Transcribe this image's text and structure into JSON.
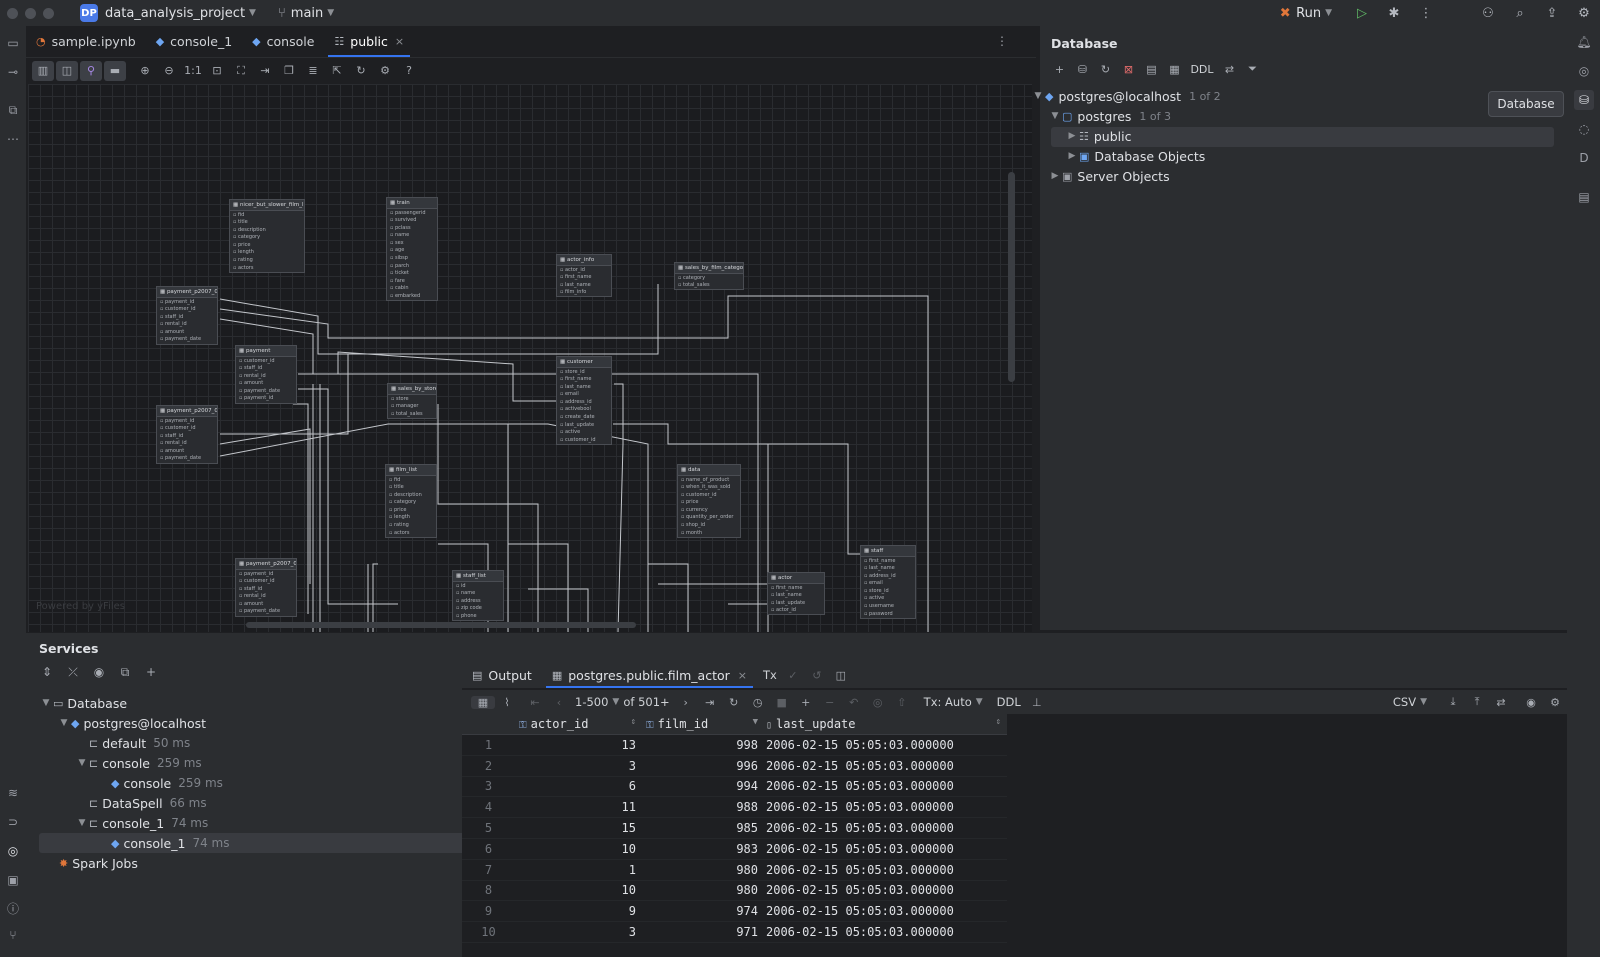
{
  "titlebar": {
    "project_badge": "DP",
    "project_name": "data_analysis_project",
    "branch": "main",
    "run_label": "Run"
  },
  "editor_tabs": [
    {
      "label": "sample.ipynb",
      "icon": "notebook-icon"
    },
    {
      "label": "console_1",
      "icon": "console-icon"
    },
    {
      "label": "console",
      "icon": "console-icon"
    },
    {
      "label": "public",
      "icon": "schema-icon",
      "active": true
    }
  ],
  "diagram": {
    "powered_by": "Powered by yFiles",
    "tables": [
      {
        "name": "nicer_but_slower_film_list",
        "cols": [
          "fid",
          "title",
          "description",
          "category",
          "price",
          "length",
          "rating",
          "actors"
        ]
      },
      {
        "name": "train",
        "cols": [
          "passengerid",
          "survived",
          "pclass",
          "name",
          "sex",
          "age",
          "sibsp",
          "parch",
          "ticket",
          "fare",
          "cabin",
          "embarked"
        ]
      },
      {
        "name": "actor_info",
        "cols": [
          "actor_id",
          "first_name",
          "last_name",
          "film_info"
        ]
      },
      {
        "name": "sales_by_film_category",
        "cols": [
          "category",
          "total_sales"
        ]
      },
      {
        "name": "payment_p2007_03",
        "cols": [
          "payment_id",
          "customer_id",
          "staff_id",
          "rental_id",
          "amount",
          "payment_date"
        ]
      },
      {
        "name": "payment",
        "cols": [
          "customer_id",
          "staff_id",
          "rental_id",
          "amount",
          "payment_date",
          "payment_id"
        ]
      },
      {
        "name": "customer",
        "cols": [
          "store_id",
          "first_name",
          "last_name",
          "email",
          "address_id",
          "activebool",
          "create_date",
          "last_update",
          "active",
          "customer_id"
        ]
      },
      {
        "name": "sales_by_store",
        "cols": [
          "store",
          "manager",
          "total_sales"
        ]
      },
      {
        "name": "payment_p2007_01",
        "cols": [
          "payment_id",
          "customer_id",
          "staff_id",
          "rental_id",
          "amount",
          "payment_date"
        ]
      },
      {
        "name": "film_list",
        "cols": [
          "fid",
          "title",
          "description",
          "category",
          "price",
          "length",
          "rating",
          "actors"
        ]
      },
      {
        "name": "data",
        "cols": [
          "name_of_product",
          "when_it_was_sold",
          "customer_id",
          "price",
          "currency",
          "quantity_per_order",
          "shop_id",
          "month"
        ]
      },
      {
        "name": "staff",
        "cols": [
          "first_name",
          "last_name",
          "address_id",
          "email",
          "store_id",
          "active",
          "username",
          "password"
        ]
      },
      {
        "name": "payment_p2007_04",
        "cols": [
          "payment_id",
          "customer_id",
          "staff_id",
          "rental_id",
          "amount",
          "payment_date"
        ]
      },
      {
        "name": "staff_list",
        "cols": [
          "id",
          "name",
          "address",
          "zip code",
          "phone"
        ]
      },
      {
        "name": "actor",
        "cols": [
          "first_name",
          "last_name",
          "last_update",
          "actor_id"
        ]
      }
    ]
  },
  "database_panel": {
    "title": "Database",
    "ddl_label": "DDL",
    "tree": [
      {
        "label": "postgres@localhost",
        "sub": "1 of 2"
      },
      {
        "label": "postgres",
        "sub": "1 of 3"
      },
      {
        "label": "public",
        "sub": ""
      },
      {
        "label": "Database Objects",
        "sub": ""
      },
      {
        "label": "Server Objects",
        "sub": ""
      }
    ],
    "tooltip": "Database"
  },
  "services": {
    "title": "Services",
    "tree": [
      {
        "label": "Database",
        "dur": ""
      },
      {
        "label": "postgres@localhost",
        "dur": ""
      },
      {
        "label": "default",
        "dur": "50 ms"
      },
      {
        "label": "console",
        "dur": "259 ms"
      },
      {
        "label": "console",
        "dur": "259 ms"
      },
      {
        "label": "DataSpell",
        "dur": "66 ms"
      },
      {
        "label": "console_1",
        "dur": "74 ms"
      },
      {
        "label": "console_1",
        "dur": "74 ms"
      },
      {
        "label": "Spark Jobs",
        "dur": ""
      }
    ]
  },
  "result": {
    "tab_output": "Output",
    "tab_table": "postgres.public.film_actor",
    "tx_label": "Tx",
    "page_range": "1-500",
    "of_total": "of 501+",
    "tx_mode": "Tx: Auto",
    "ddl_label": "DDL",
    "format": "CSV",
    "columns": [
      "actor_id",
      "film_id",
      "last_update"
    ],
    "rows": [
      [
        "1",
        "13",
        "998",
        "2006-02-15 05:05:03.000000"
      ],
      [
        "2",
        "3",
        "996",
        "2006-02-15 05:05:03.000000"
      ],
      [
        "3",
        "6",
        "994",
        "2006-02-15 05:05:03.000000"
      ],
      [
        "4",
        "11",
        "988",
        "2006-02-15 05:05:03.000000"
      ],
      [
        "5",
        "15",
        "985",
        "2006-02-15 05:05:03.000000"
      ],
      [
        "6",
        "10",
        "983",
        "2006-02-15 05:05:03.000000"
      ],
      [
        "7",
        "1",
        "980",
        "2006-02-15 05:05:03.000000"
      ],
      [
        "8",
        "10",
        "980",
        "2006-02-15 05:05:03.000000"
      ],
      [
        "9",
        "9",
        "974",
        "2006-02-15 05:05:03.000000"
      ],
      [
        "10",
        "3",
        "971",
        "2006-02-15 05:05:03.000000"
      ]
    ]
  }
}
